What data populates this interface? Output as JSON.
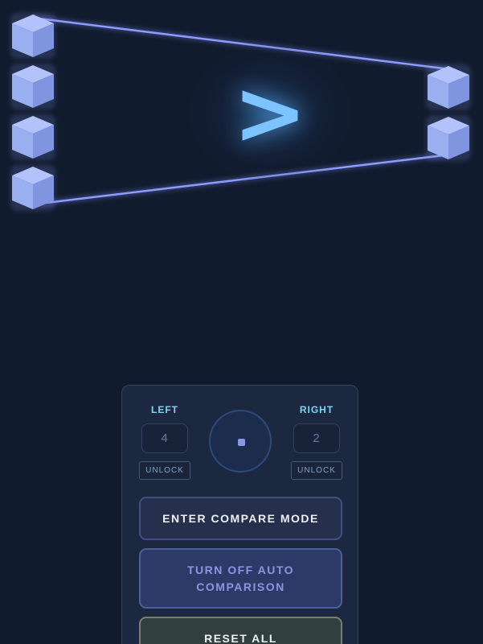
{
  "scene": {
    "comparison_symbol": ">",
    "left_stack_count": 4,
    "right_stack_count": 2,
    "colors": {
      "background": "#111b2e",
      "block_face": "#9cb0f2",
      "beam": "#7f8ff7",
      "symbol": "#7cc4ff"
    }
  },
  "controls": {
    "left": {
      "label": "LEFT",
      "count": "4",
      "unlock_label": "UNLOCK"
    },
    "right": {
      "label": "RIGHT",
      "count": "2",
      "unlock_label": "UNLOCK"
    },
    "compare_mode_label": "ENTER COMPARE MODE",
    "auto_comparison_label": "TURN OFF AUTO COMPARISON",
    "reset_label": "RESET ALL"
  }
}
